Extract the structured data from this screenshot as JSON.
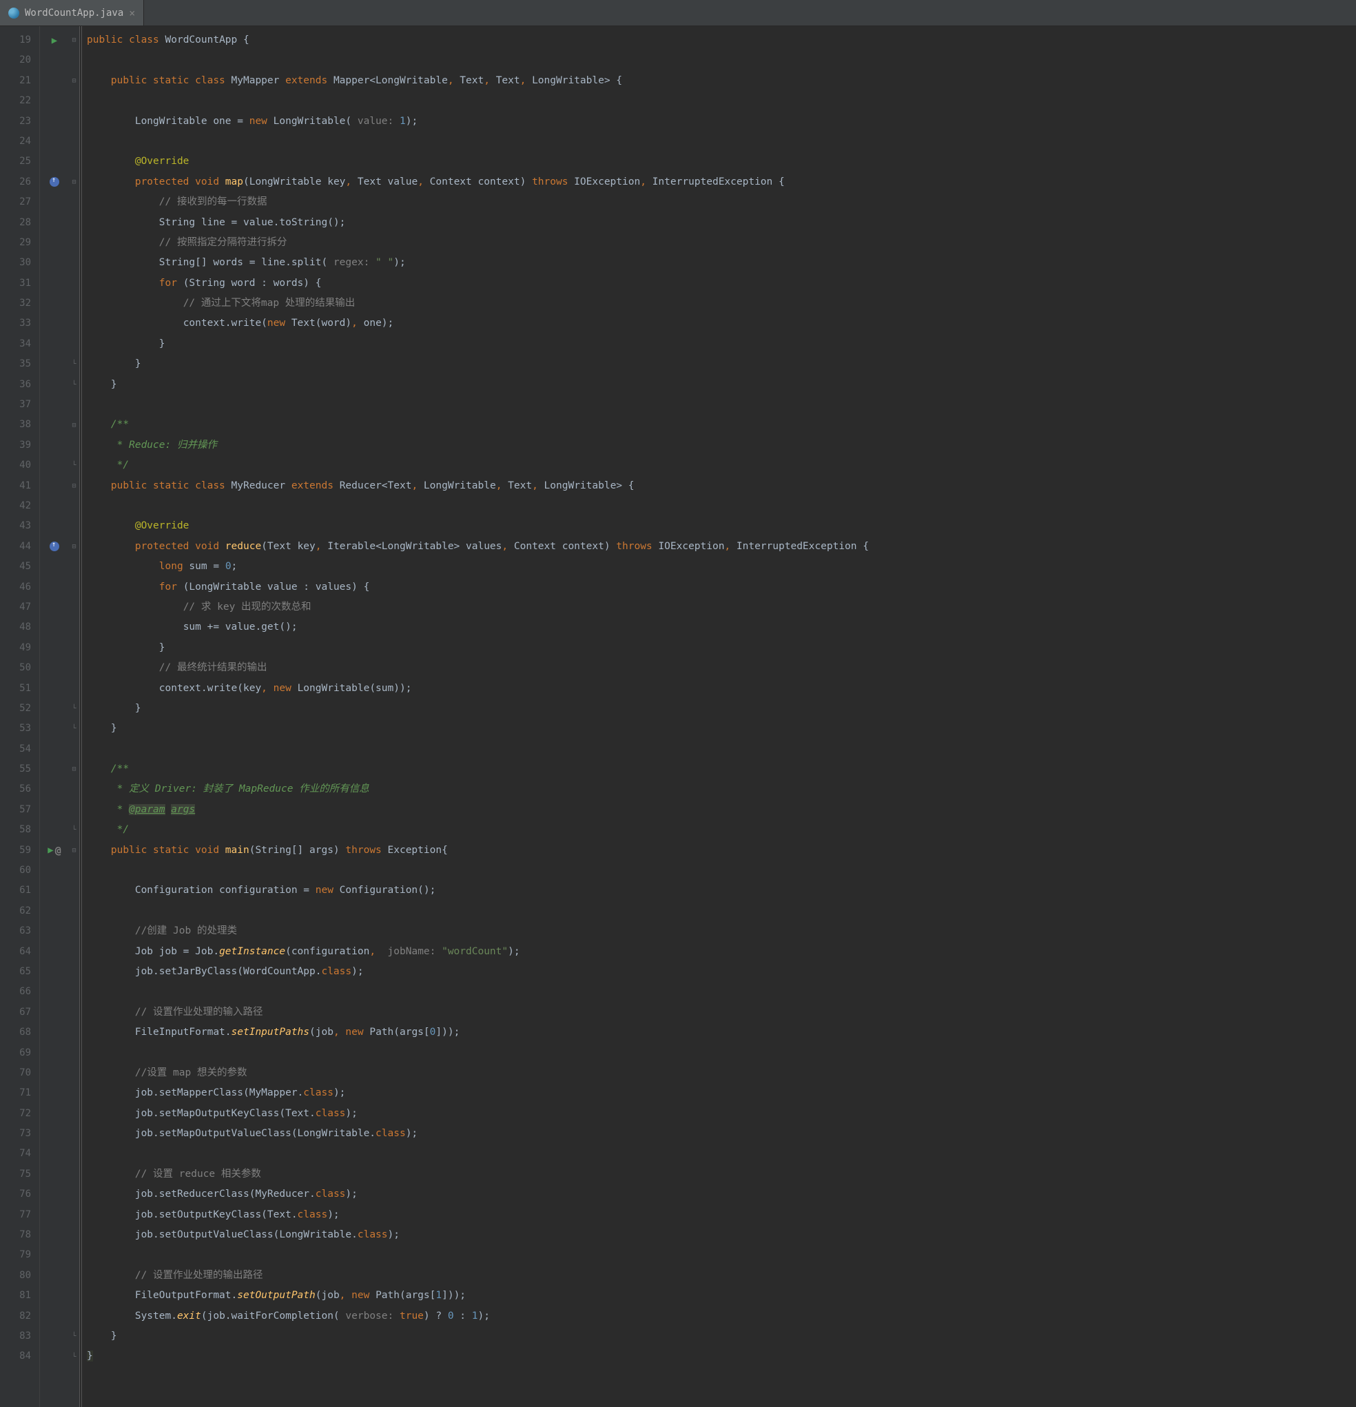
{
  "tab": {
    "label": "WordCountApp.java",
    "close": "×"
  },
  "gutter": {
    "lines": [
      "19",
      "20",
      "21",
      "22",
      "23",
      "24",
      "25",
      "26",
      "27",
      "28",
      "29",
      "30",
      "31",
      "32",
      "33",
      "34",
      "35",
      "36",
      "37",
      "38",
      "39",
      "40",
      "41",
      "42",
      "43",
      "44",
      "45",
      "46",
      "47",
      "48",
      "49",
      "50",
      "51",
      "52",
      "53",
      "54",
      "55",
      "56",
      "57",
      "58",
      "59",
      "60",
      "61",
      "62",
      "63",
      "64",
      "65",
      "66",
      "67",
      "68",
      "69",
      "70",
      "71",
      "72",
      "73",
      "74",
      "75",
      "76",
      "77",
      "78",
      "79",
      "80",
      "81",
      "82",
      "83",
      "84"
    ]
  },
  "code": {
    "l19": {
      "indent": "",
      "k1": "public class ",
      "c1": "WordCountApp ",
      "b": "{"
    },
    "l21": {
      "indent": "    ",
      "k1": "public static class ",
      "c1": "MyMapper ",
      "k2": "extends ",
      "c2": "Mapper<LongWritable",
      "p1": ", ",
      "c3": "Text",
      "p2": ", ",
      "c4": "Text",
      "p3": ", ",
      "c5": "LongWritable> {"
    },
    "l23": {
      "indent": "        ",
      "t1": "LongWritable one = ",
      "k1": "new ",
      "t2": "LongWritable(",
      "par": " value: ",
      "n": "1",
      "t3": ");"
    },
    "l25": {
      "indent": "        ",
      "a": "@Override"
    },
    "l26": {
      "indent": "        ",
      "k1": "protected void ",
      "fn": "map",
      "t1": "(LongWritable key",
      "p1": ", ",
      "t2": "Text value",
      "p2": ", ",
      "t3": "Context context) ",
      "k2": "throws ",
      "t4": "IOException",
      "p3": ", ",
      "t5": "InterruptedException {"
    },
    "l27": {
      "indent": "            ",
      "c": "// 接收到的每一行数据"
    },
    "l28": {
      "indent": "            ",
      "t1": "String line = value.toString();"
    },
    "l29": {
      "indent": "            ",
      "c": "// 按照指定分隔符进行拆分"
    },
    "l30": {
      "indent": "            ",
      "t1": "String[] words = line.split(",
      "par": " regex: ",
      "s": "\" \"",
      "t2": ");"
    },
    "l31": {
      "indent": "            ",
      "k1": "for ",
      "t1": "(String word : words) {"
    },
    "l32": {
      "indent": "                ",
      "c": "// 通过上下文将map 处理的结果输出"
    },
    "l33": {
      "indent": "                ",
      "t1": "context.write(",
      "k1": "new ",
      "t2": "Text(word)",
      "p": ", ",
      "t3": "one);"
    },
    "l34": {
      "indent": "            ",
      "b": "}"
    },
    "l35": {
      "indent": "        ",
      "b": "}"
    },
    "l36": {
      "indent": "    ",
      "b": "}"
    },
    "l38": {
      "indent": "    ",
      "d": "/**"
    },
    "l39": {
      "indent": "     ",
      "d": "* Reduce: 归并操作"
    },
    "l40": {
      "indent": "     ",
      "d": "*/"
    },
    "l41": {
      "indent": "    ",
      "k1": "public static class ",
      "c1": "MyReducer ",
      "k2": "extends ",
      "c2": "Reducer<Text",
      "p1": ", ",
      "c3": "LongWritable",
      "p2": ", ",
      "c4": "Text",
      "p3": ", ",
      "c5": "LongWritable> {"
    },
    "l43": {
      "indent": "        ",
      "a": "@Override"
    },
    "l44": {
      "indent": "        ",
      "k1": "protected void ",
      "fn": "reduce",
      "t1": "(Text key",
      "p1": ", ",
      "t2": "Iterable<LongWritable> values",
      "p2": ", ",
      "t3": "Context context) ",
      "k2": "throws ",
      "t4": "IOException",
      "p3": ", ",
      "t5": "InterruptedException {"
    },
    "l45": {
      "indent": "            ",
      "k1": "long ",
      "t1": "sum = ",
      "n": "0",
      "t2": ";"
    },
    "l46": {
      "indent": "            ",
      "k1": "for ",
      "t1": "(LongWritable value : values) {"
    },
    "l47": {
      "indent": "                ",
      "c": "// 求 key 出现的次数总和"
    },
    "l48": {
      "indent": "                ",
      "t": "sum += value.get();"
    },
    "l49": {
      "indent": "            ",
      "b": "}"
    },
    "l50": {
      "indent": "            ",
      "c": "// 最终统计结果的输出"
    },
    "l51": {
      "indent": "            ",
      "t1": "context.write(key",
      "p": ", ",
      "k1": "new ",
      "t2": "LongWritable(sum));"
    },
    "l52": {
      "indent": "        ",
      "b": "}"
    },
    "l53": {
      "indent": "    ",
      "b": "}"
    },
    "l55": {
      "indent": "    ",
      "d": "/**"
    },
    "l56": {
      "indent": "     ",
      "d": "* 定义 Driver: 封装了 MapReduce 作业的所有信息"
    },
    "l57": {
      "indent": "     ",
      "d1": "* ",
      "dp": "@param",
      "sp": " ",
      "dp2": "args"
    },
    "l58": {
      "indent": "     ",
      "d": "*/"
    },
    "l59": {
      "indent": "    ",
      "k1": "public static void ",
      "fn": "main",
      "t1": "(String[] args) ",
      "k2": "throws ",
      "t2": "Exception{"
    },
    "l61": {
      "indent": "        ",
      "t1": "Configuration configuration = ",
      "k1": "new ",
      "t2": "Configuration();"
    },
    "l63": {
      "indent": "        ",
      "c": "//创建 Job 的处理类"
    },
    "l64": {
      "indent": "        ",
      "t1": "Job job = Job.",
      "sf": "getInstance",
      "t2": "(configuration",
      "p": ",  ",
      "par": "jobName: ",
      "s": "\"wordCount\"",
      "t3": ");"
    },
    "l65": {
      "indent": "        ",
      "t1": "job.setJarByClass(WordCountApp.",
      "k1": "class",
      "t2": ");"
    },
    "l67": {
      "indent": "        ",
      "c": "// 设置作业处理的输入路径"
    },
    "l68": {
      "indent": "        ",
      "t1": "FileInputFormat.",
      "sf": "setInputPaths",
      "t2": "(job",
      "p": ", ",
      "k1": "new ",
      "t3": "Path(args[",
      "n": "0",
      "t4": "]));"
    },
    "l70": {
      "indent": "        ",
      "c": "//设置 map 想关的参数"
    },
    "l71": {
      "indent": "        ",
      "t1": "job.setMapperClass(MyMapper.",
      "k1": "class",
      "t2": ");"
    },
    "l72": {
      "indent": "        ",
      "t1": "job.setMapOutputKeyClass(Text.",
      "k1": "class",
      "t2": ");"
    },
    "l73": {
      "indent": "        ",
      "t1": "job.setMapOutputValueClass(LongWritable.",
      "k1": "class",
      "t2": ");"
    },
    "l75": {
      "indent": "        ",
      "c": "// 设置 reduce 相关参数"
    },
    "l76": {
      "indent": "        ",
      "t1": "job.setReducerClass(MyReducer.",
      "k1": "class",
      "t2": ");"
    },
    "l77": {
      "indent": "        ",
      "t1": "job.setOutputKeyClass(Text.",
      "k1": "class",
      "t2": ");"
    },
    "l78": {
      "indent": "        ",
      "t1": "job.setOutputValueClass(LongWritable.",
      "k1": "class",
      "t2": ");"
    },
    "l80": {
      "indent": "        ",
      "c": "// 设置作业处理的输出路径"
    },
    "l81": {
      "indent": "        ",
      "t1": "FileOutputFormat.",
      "sf": "setOutputPath",
      "t2": "(job",
      "p": ", ",
      "k1": "new ",
      "t3": "Path(args[",
      "n": "1",
      "t4": "]));"
    },
    "l82": {
      "indent": "        ",
      "t1": "System.",
      "sf": "exit",
      "t2": "(job.waitForCompletion(",
      "par": " verbose: ",
      "k1": "true",
      "t3": ") ? ",
      "n1": "0",
      "t4": " : ",
      "n2": "1",
      "t5": ");"
    },
    "l83": {
      "indent": "    ",
      "b": "}"
    },
    "l84": {
      "indent": "",
      "b": "}"
    }
  }
}
